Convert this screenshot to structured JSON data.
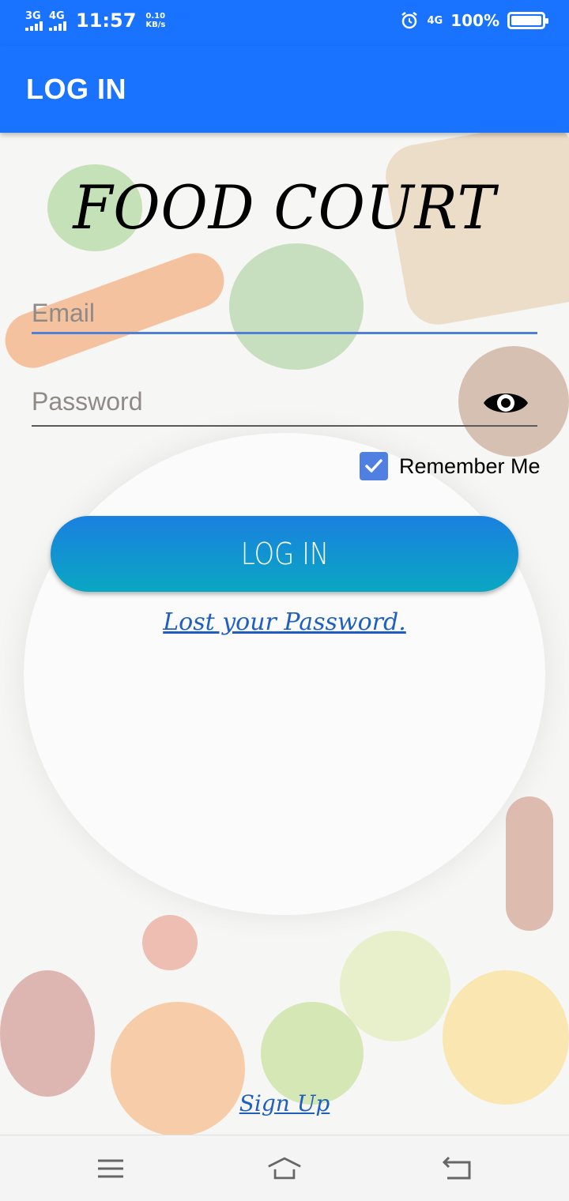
{
  "status_bar": {
    "signal1": "3G",
    "signal2": "4G",
    "time": "11:57",
    "speed_value": "0.10",
    "speed_unit": "KB/s",
    "network": "4G",
    "battery_percent": "100%",
    "battery_level": 1.0
  },
  "app_bar": {
    "title": "LOG IN"
  },
  "form": {
    "app_name": "FOOD COURT",
    "email_placeholder": "Email",
    "password_placeholder": "Password",
    "remember_label": "Remember Me",
    "remember_checked": true,
    "login_label": "LOG IN",
    "lost_password": "Lost your Password.",
    "sign_up": "Sign Up"
  },
  "colors": {
    "primary": "#1a73ff",
    "button_top": "#1a80e0",
    "button_bottom": "#0aa7c2",
    "link": "#1e5fbf",
    "checkbox": "#4f7fe0"
  },
  "icons": [
    "alarm-icon",
    "eye-icon",
    "check-icon",
    "menu-icon",
    "home-icon",
    "back-icon"
  ]
}
